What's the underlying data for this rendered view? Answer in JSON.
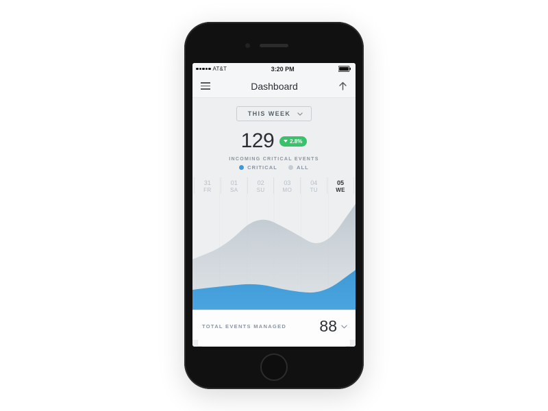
{
  "status": {
    "carrier": "AT&T",
    "time": "3:20 PM"
  },
  "header": {
    "title": "Dashboard"
  },
  "range": {
    "label": "THIS WEEK"
  },
  "metric": {
    "value": "129",
    "delta": "2.8%"
  },
  "subtitle": "INCOMING CRITICAL EVENTS",
  "legend": {
    "critical": "CRITICAL",
    "all": "ALL"
  },
  "axis": {
    "days": [
      "31",
      "01",
      "02",
      "03",
      "04",
      "05"
    ],
    "dows": [
      "FR",
      "SA",
      "SU",
      "MO",
      "TU",
      "WE"
    ],
    "active_index": 5
  },
  "footer": {
    "label": "TOTAL EVENTS MANAGED",
    "value": "88"
  },
  "colors": {
    "critical": "#3e9ad6",
    "all": "#aeb9c2",
    "badge": "#39c26b"
  },
  "chart_data": {
    "type": "area",
    "title": "Incoming Critical Events",
    "xlabel": "",
    "ylabel": "",
    "categories": [
      "31 FR",
      "01 SA",
      "02 SU",
      "03 MO",
      "04 TU",
      "05 WE"
    ],
    "ylim": [
      0,
      100
    ],
    "series": [
      {
        "name": "ALL",
        "values": [
          38,
          48,
          72,
          60,
          45,
          80
        ]
      },
      {
        "name": "CRITICAL",
        "values": [
          15,
          18,
          20,
          14,
          12,
          30
        ]
      }
    ],
    "legend_position": "top"
  }
}
